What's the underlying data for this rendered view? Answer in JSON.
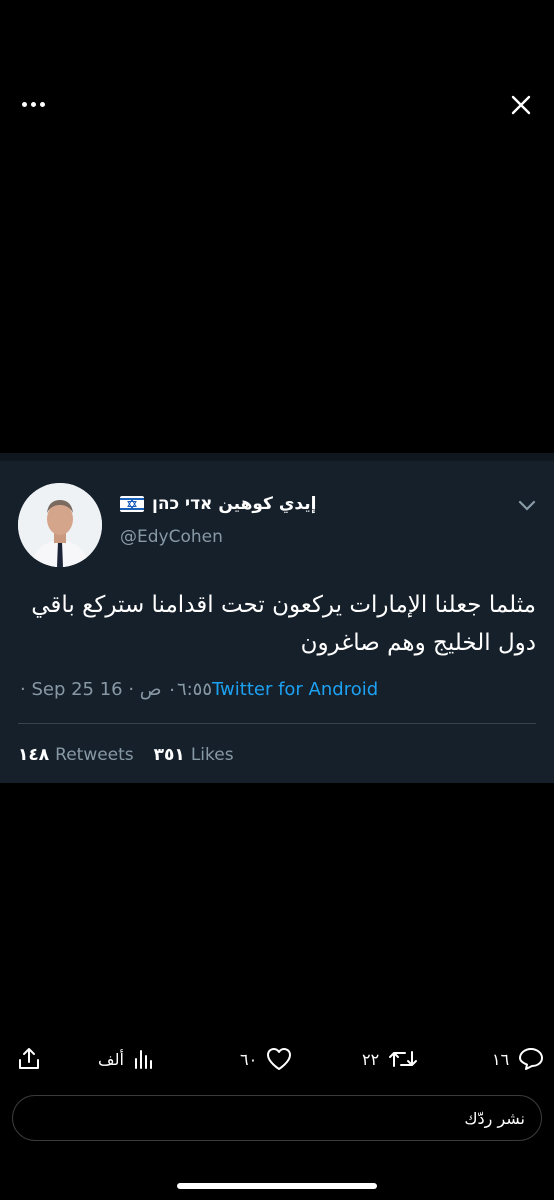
{
  "tweet": {
    "display_name": "إيدي كوهين אדי כהן",
    "handle": "@EdyCohen",
    "text": "مثلما جعلنا الإمارات يركعون تحت اقدامنا ستركع باقي دول الخليج وهم صاغرون",
    "timestamp": "· Sep 25 16 · ٠٦:٥٥ ص",
    "source": "Twitter for Android",
    "retweets_count": "١٤٨",
    "retweets_label": "Retweets",
    "likes_count": "٣٥١",
    "likes_label": "Likes"
  },
  "actions": {
    "views_count": "ألف",
    "likes_count": "٦٠",
    "retweets_count": "٢٢",
    "replies_count": "١٦"
  },
  "reply": {
    "placeholder": "نشر ردّك"
  },
  "icons": [
    "more-icon",
    "close-icon",
    "chevron-down-icon",
    "share-icon",
    "views-icon",
    "heart-icon",
    "retweet-icon",
    "reply-icon"
  ]
}
